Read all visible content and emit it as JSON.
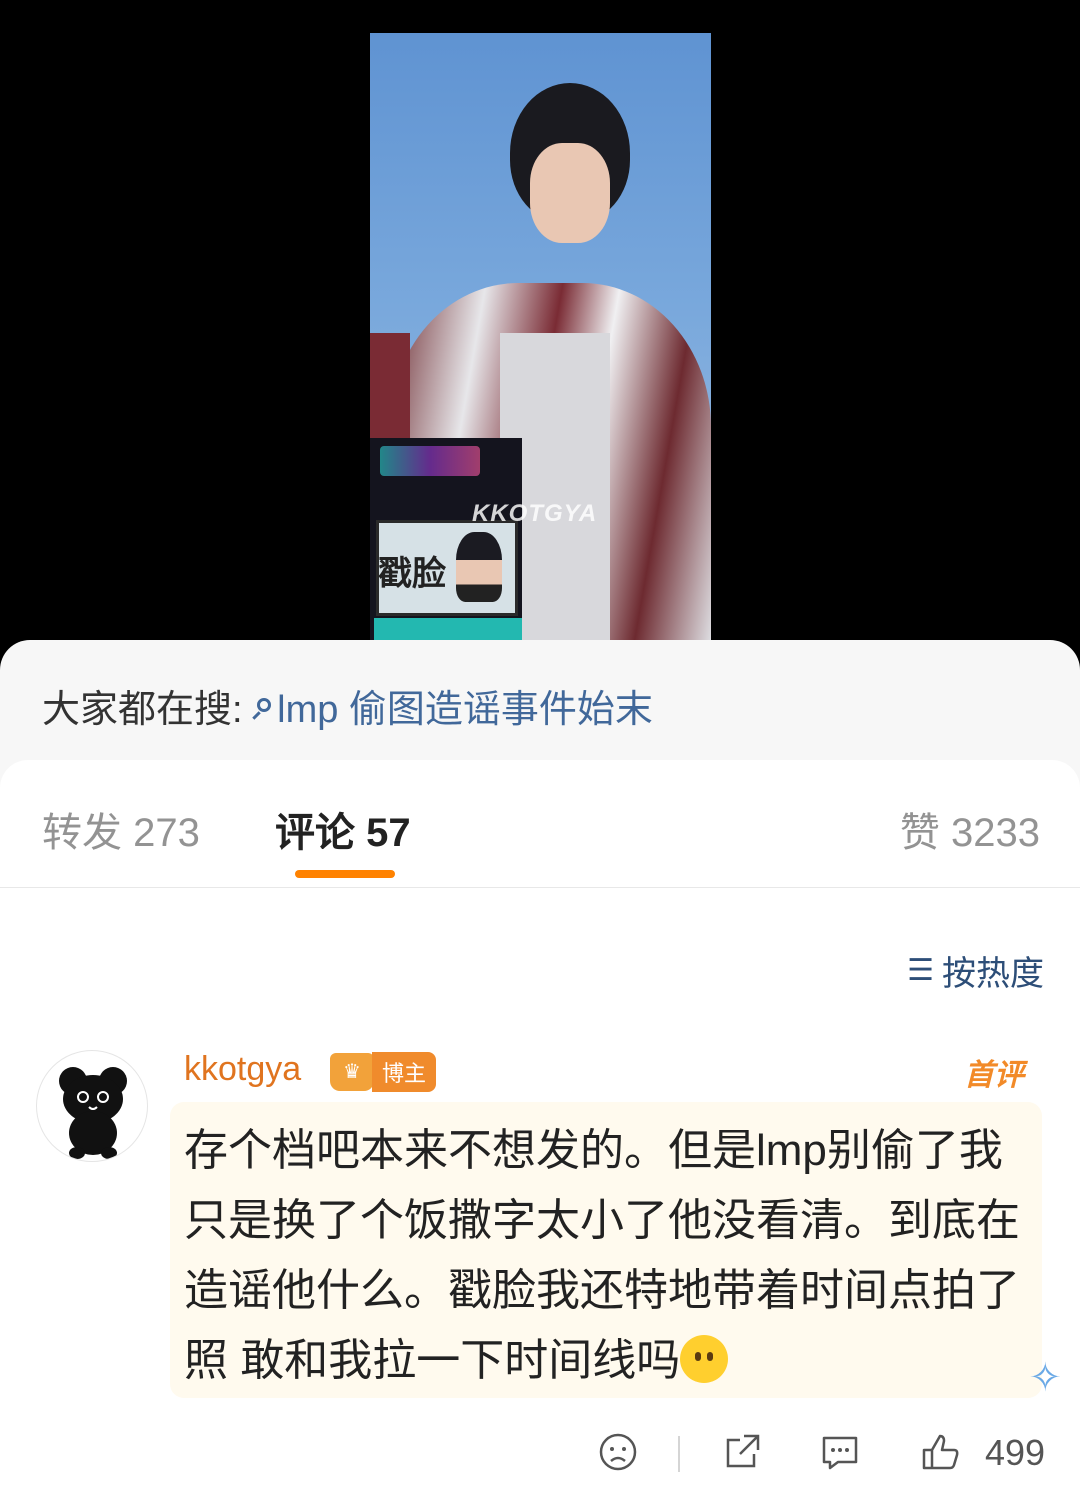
{
  "media": {
    "watermark": "KKOTGYA",
    "sign_text": "戳脸"
  },
  "hot_search": {
    "prefix": "大家都在搜:",
    "query": "lmp 偷图造谣事件始末"
  },
  "tabs": [
    {
      "label": "转发 273"
    },
    {
      "label": "评论 57"
    },
    {
      "label": "赞 3233"
    }
  ],
  "colors": {
    "accent": "#ff8200",
    "link": "#41689a",
    "username": "#e0741f"
  },
  "sort": {
    "label": "按热度",
    "icon": "sort-icon"
  },
  "comment": {
    "username": "kkotgya",
    "badge_tag": "博主",
    "first_tag": "首评",
    "text": "存个档吧本来不想发的。但是lmp别偷了我只是换了个饭撒字太小了他没看清。到底在造谣他什么。戳脸我还特地带着时间点拍了照 敢和我拉一下时间线吗",
    "like_count": "499",
    "avatar_icon": "black-bear-avatar"
  }
}
